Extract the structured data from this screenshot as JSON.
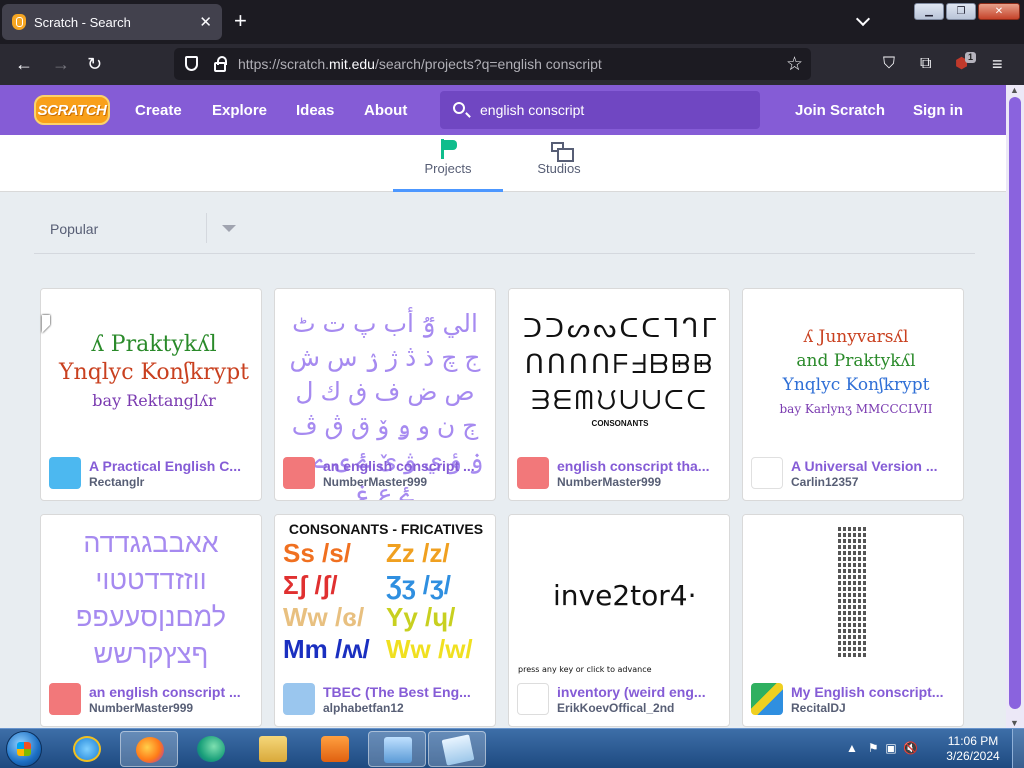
{
  "browser": {
    "tab_title": "Scratch - Search",
    "url_host_prefix": "https://scratch.",
    "url_host": "mit.edu",
    "url_path": "/search/projects?q=english conscript",
    "ext_badge": "1"
  },
  "header": {
    "logo": "SCRATCH",
    "nav": [
      "Create",
      "Explore",
      "Ideas",
      "About"
    ],
    "search_query": "english conscript",
    "join": "Join Scratch",
    "signin": "Sign in"
  },
  "tabs": {
    "projects": "Projects",
    "studios": "Studios"
  },
  "sort": {
    "selected": "Popular"
  },
  "projects": [
    {
      "title": "A Practical English C...",
      "author": "Rectanglr"
    },
    {
      "title": "an english conscript ...",
      "author": "NumberMaster999"
    },
    {
      "title": "english conscript tha...",
      "author": "NumberMaster999"
    },
    {
      "title": "A Universal Version ...",
      "author": "Carlin12357"
    },
    {
      "title": "an english conscript ...",
      "author": "NumberMaster999"
    },
    {
      "title": "TBEC (The Best Eng...",
      "author": "alphabetfan12"
    },
    {
      "title": "inventory (weird eng...",
      "author": "ErikKoevOffical_2nd"
    },
    {
      "title": "My English conscript...",
      "author": "RecitalDJ"
    }
  ],
  "thumbs": {
    "t1": [
      "ʎ Praktykʎl",
      "Ynqlyc Konʃkrypt",
      "bay Rektanglʎr"
    ],
    "t2": "الي ٷ أب پ ت ٹ ج چ ذ ڎ ژ ۯ س ش ص ض ف ڧ ك ل ڄ ن و ۅ ۆ ق ڨ ڤ ۏ ؤ ي ۋ ێ ۓ ۍ ے ی ۓ ع ۼ",
    "t3": [
      "ᑐᑐᔕᔓᑕᑕᒣᒉᒥ",
      "ᑎᑎᑎᑎᖴᖵᗷᗸᗸ",
      "ᗱᗴᗰᙀᑌᑌᑕᑕ"
    ],
    "t3_label": "CONSONANTS",
    "t4": [
      "ʎ Junyvarsʎl",
      "and Praktykʎl",
      "Ynqlyc Konʃkrypt",
      "bay Karlynʒ MMCCCLVII"
    ],
    "t5": "אאבבגגדדה ווזזדדטטוי למםנןסעעפפ ףצץקרשש",
    "t6_header": "CONSONANTS - FRICATIVES",
    "t6_rows": [
      [
        "Ss /s/",
        "Zz /z/"
      ],
      [
        "Ʃʃ /ʃ/",
        "Ʒʒ /ʒ/"
      ],
      [
        "Ww /ɞ/",
        "Yy /ɥ/"
      ],
      [
        "Mm /ʍ/",
        "Ww /w/"
      ]
    ],
    "t7": "inve2tor4·",
    "t7_caption": "press any key or click to advance"
  },
  "taskbar": {
    "time": "11:06 PM",
    "date": "3/26/2024"
  },
  "colors": {
    "scratch_purple": "#855cd6",
    "link_purple": "#855cd6",
    "tab_active": "#4c97ff"
  }
}
